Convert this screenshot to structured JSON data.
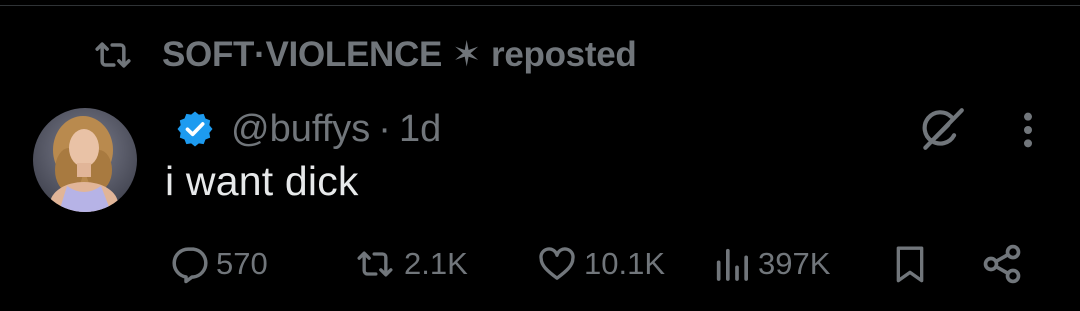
{
  "repost": {
    "reposter": "SOFT·VIOLENCE",
    "symbol": "✶",
    "label": "reposted"
  },
  "post": {
    "handle": "@buffys",
    "separator": "·",
    "time": "1d",
    "text": "i want dick",
    "verified": true
  },
  "actions": {
    "replies": "570",
    "reposts": "2.1K",
    "likes": "10.1K",
    "views": "397K"
  },
  "icons": {
    "repost_header": "repost-icon",
    "verified": "verified-badge-icon",
    "grok": "grok-icon",
    "more": "more-dots-icon",
    "reply": "reply-icon",
    "repost": "repost-icon",
    "like": "heart-icon",
    "views": "views-chart-icon",
    "bookmark": "bookmark-icon",
    "share": "share-icon"
  },
  "colors": {
    "background": "#000000",
    "text": "#e7e9ea",
    "muted": "#71767b",
    "verified": "#1d9bf0"
  }
}
